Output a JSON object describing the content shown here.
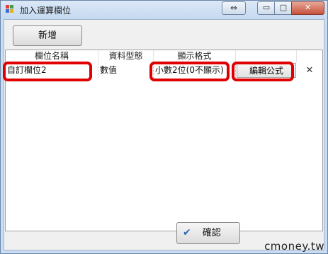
{
  "window": {
    "title": "加入運算欄位"
  },
  "titlebar": {
    "extra_symbol": "⇔",
    "min_symbol": "▭",
    "max_symbol": "□",
    "close_symbol": "✕"
  },
  "toolbar": {
    "add_label": "新增"
  },
  "grid": {
    "columns": [
      "欄位名稱",
      "資料型態",
      "顯示格式"
    ],
    "row": {
      "name": "自訂欄位2",
      "type": "數值",
      "format": "小數2位(0不顯示)",
      "edit_label": "編輯公式",
      "delete_symbol": "✕"
    }
  },
  "footer": {
    "ok_label": "確認",
    "ok_icon": "✔"
  },
  "watermark": "cmoney.tw",
  "colors": {
    "highlight": "#e00000",
    "accent": "#2c6ab5"
  }
}
